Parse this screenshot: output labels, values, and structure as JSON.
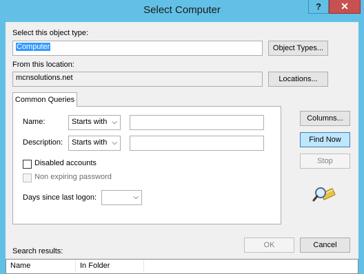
{
  "window": {
    "title": "Select Computer",
    "help_label": "?",
    "close_label": "✕"
  },
  "object_type": {
    "label": "Select this object type:",
    "value": "Computer",
    "button": "Object Types..."
  },
  "location": {
    "label": "From this location:",
    "value": "mcnsolutions.net",
    "button": "Locations..."
  },
  "queries": {
    "tab_label": "Common Queries",
    "name_label": "Name:",
    "name_mode": "Starts with",
    "name_value": "",
    "description_label": "Description:",
    "description_mode": "Starts with",
    "description_value": "",
    "disabled_accounts_label": "Disabled accounts",
    "disabled_accounts_checked": false,
    "non_expiring_label": "Non expiring password",
    "non_expiring_checked": false,
    "days_label": "Days since last logon:",
    "days_value": ""
  },
  "actions": {
    "columns": "Columns...",
    "find_now": "Find Now",
    "stop": "Stop",
    "ok": "OK",
    "cancel": "Cancel"
  },
  "results": {
    "label": "Search results:",
    "columns": [
      "Name",
      "In Folder"
    ]
  }
}
